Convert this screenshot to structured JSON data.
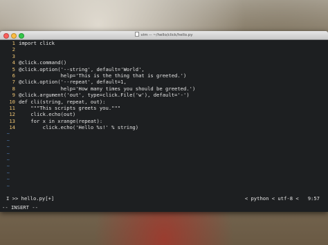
{
  "window": {
    "title": "vim --  ~/hello/click/hello.py"
  },
  "editor": {
    "lines": [
      {
        "n": "1",
        "t": "import click"
      },
      {
        "n": "2",
        "t": ""
      },
      {
        "n": "3",
        "t": ""
      },
      {
        "n": "4",
        "t": "@click.command()"
      },
      {
        "n": "5",
        "t": "@click.option('--string', default='World',"
      },
      {
        "n": "6",
        "t": "              help='This is the thing that is greeted.')"
      },
      {
        "n": "7",
        "t": "@click.option('--repeat', default=1,"
      },
      {
        "n": "8",
        "t": "              help='How many times you should be greeted.')"
      },
      {
        "n": "9",
        "t": "@click.argument('out', type=click.File('w'), default='-')"
      },
      {
        "n": "10",
        "t": "def cli(string, repeat, out):"
      },
      {
        "n": "11",
        "t": "    \"\"\"This scripts greets you.\"\"\""
      },
      {
        "n": "12",
        "t": "    click.echo(out)"
      },
      {
        "n": "13",
        "t": "    for x in xrange(repeat):"
      },
      {
        "n": "14",
        "t": "        click.echo('Hello %s!' % string)"
      }
    ],
    "empty_marker": "~"
  },
  "status": {
    "mode_marker": "I",
    "file": ">> hello.py[+]",
    "filetype": "< python < utf-8 <",
    "position": "9:57"
  },
  "mode_line": "-- INSERT --"
}
